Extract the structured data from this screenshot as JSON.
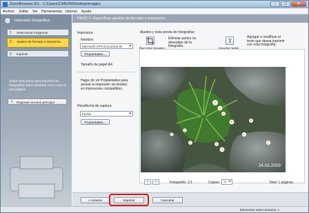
{
  "window": {
    "title": "ZoomBrowser EX - C:\\Users\\CANON\\Desktop\\images",
    "minimize_glyph": "–",
    "maximize_glyph": "□",
    "close_glyph": "✕"
  },
  "menu": [
    "Archivo",
    "Editar",
    "Ver",
    "Herramientas",
    "Internet",
    "Ayuda"
  ],
  "sidebar": {
    "title": "Impresión fotográfica",
    "steps": [
      {
        "num": "1",
        "label": "Seleccionar imágenes"
      },
      {
        "num": "2",
        "label": "Ajustes de formato e impresora"
      },
      {
        "num": "3",
        "label": "Imprimir"
      }
    ],
    "description": "Utilice esta tarea para imprimir las fotografías seleccionadas como una en una página.",
    "back_button": "Regresar al menú principal",
    "back_icon": "↰"
  },
  "main": {
    "step_title": "PASO 2: Especificar ajustes de formato e impresora.",
    "printer_section": "Impresora",
    "name_label": "Nombre:",
    "printer_value": "Microsoft XPS Document W",
    "properties_button": "Propiedades...",
    "paper_size": "Tamaño de papel:A4",
    "properties_hint": "Haga clic en Propiedades para activar la impresión sin bordes en impresoras compatibles.",
    "datetime_label": "Hora/fecha de captura",
    "datetime_value": "Fecha",
    "properties_button_2": "Propiedades...",
    "preview_section": "Ajustes y vista previa de fotografías",
    "trim_label": "Recortar imagen",
    "trim_desc": "Eliminar partes no deseadas de la fotografía.",
    "text_label": "Insertar texto",
    "text_icon": "T",
    "text_desc": "Agregar o modificar el texto que desea imprimir con esta fotografía.",
    "photo_date": "24.03.2009",
    "photo_counter": "Fotografía: 1/1",
    "copies_label": "Copias:",
    "copies_value": "1",
    "total_pages": "Total: 1 páginas",
    "prev_glyph": "<",
    "next_glyph": ">"
  },
  "bottom": {
    "previous_button": "< Anterior",
    "print_button": "Imprimir",
    "cancel_button": "Cancelar"
  },
  "status": {
    "selected": "Elementos seleccionados: 1"
  }
}
